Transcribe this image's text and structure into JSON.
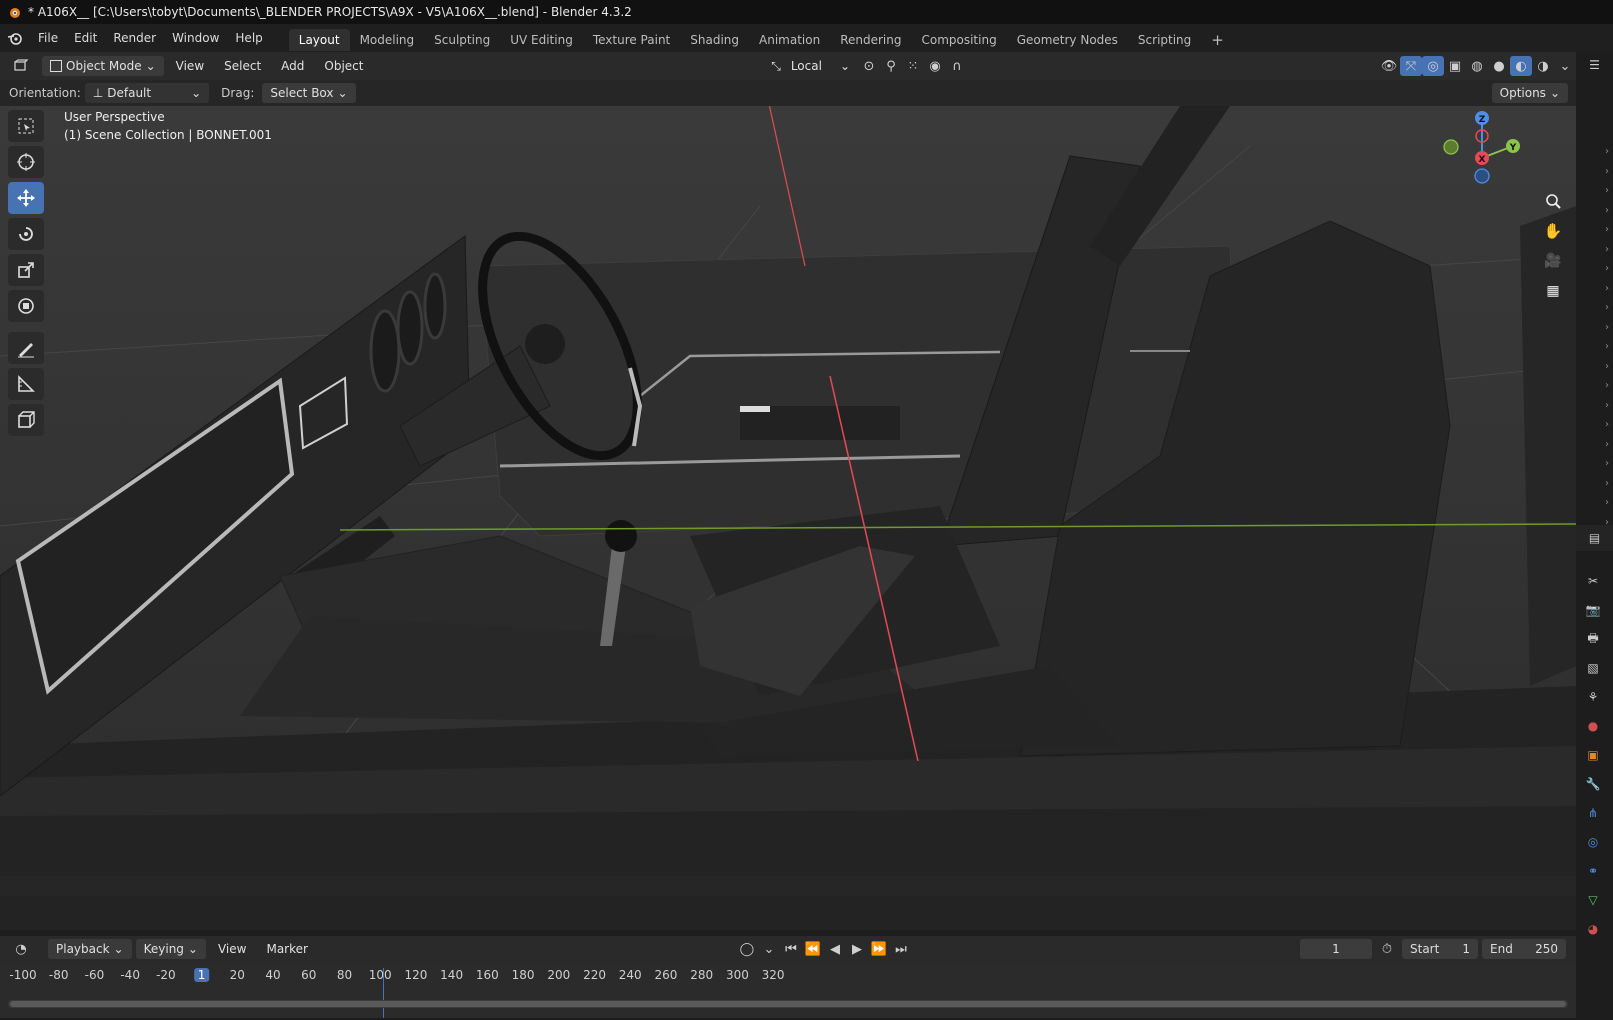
{
  "titlebar": {
    "title": "* A106X__ [C:\\Users\\tobyt\\Documents\\_BLENDER PROJECTS\\A9X - V5\\A106X__.blend] - Blender 4.3.2"
  },
  "menu": {
    "items": [
      "File",
      "Edit",
      "Render",
      "Window",
      "Help"
    ]
  },
  "workspaces": {
    "tabs": [
      "Layout",
      "Modeling",
      "Sculpting",
      "UV Editing",
      "Texture Paint",
      "Shading",
      "Animation",
      "Rendering",
      "Compositing",
      "Geometry Nodes",
      "Scripting"
    ],
    "active": "Layout",
    "add": "+"
  },
  "header": {
    "mode": "Object Mode",
    "menus": [
      "View",
      "Select",
      "Add",
      "Object"
    ],
    "transform_orientation": "Local"
  },
  "tool_settings": {
    "orientation_label": "Orientation:",
    "orientation_value": "Default",
    "drag_label": "Drag:",
    "drag_value": "Select Box",
    "options": "Options"
  },
  "viewport": {
    "perspective": "User Perspective",
    "collection": "(1) Scene Collection | BONNET.001",
    "gizmo": {
      "x": "X",
      "y": "Y",
      "z": "Z"
    }
  },
  "colors": {
    "accent": "#4772b3",
    "x_axis": "#e34a55",
    "y_axis": "#8bc34a",
    "z_axis": "#4f8ee6"
  },
  "timeline": {
    "menus": [
      "Playback",
      "Keying",
      "View",
      "Marker"
    ],
    "current_frame": "1",
    "start_label": "Start",
    "start_value": "1",
    "end_label": "End",
    "end_value": "250",
    "ticks": [
      "-100",
      "-80",
      "-60",
      "-40",
      "-20",
      "1",
      "20",
      "40",
      "60",
      "80",
      "100",
      "120",
      "140",
      "160",
      "180",
      "200",
      "220",
      "240",
      "260",
      "280",
      "300",
      "320"
    ]
  },
  "icons": {
    "tools": [
      "select-box-icon",
      "cursor-icon",
      "move-icon",
      "rotate-icon",
      "scale-icon",
      "transform-icon",
      "annotate-icon",
      "measure-icon",
      "add-cube-icon"
    ],
    "properties": [
      "tool-icon",
      "render-icon",
      "output-icon",
      "view-layer-icon",
      "scene-icon",
      "world-icon",
      "object-icon",
      "modifier-icon",
      "particles-icon",
      "physics-icon",
      "constraints-icon",
      "data-icon",
      "material-icon"
    ]
  }
}
